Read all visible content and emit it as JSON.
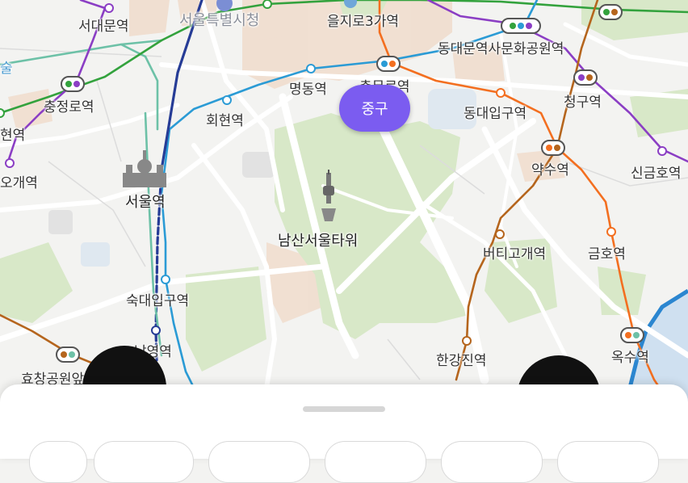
{
  "map": {
    "district_badge": "중구",
    "landmark_tower": "남산서울타워",
    "labels": {
      "seodaemun": "서대문역",
      "cityhall": "서울특별시청",
      "euljiro3": "을지로3가역",
      "ddp": "동대문역사문화공원역",
      "myeongdong": "명동역",
      "chungmuro": "충무로역",
      "dongdae": "동대입구역",
      "cheonggu": "청구역",
      "chungjeongno": "충정로역",
      "hoehyeon": "회현역",
      "aeogae_partial": "현역",
      "aeogae2": "오개역",
      "seoul_station": "서울역",
      "yaksu": "약수역",
      "singeumho": "신금호역",
      "beotigogae": "버티고개역",
      "geumho": "금호역",
      "sookmyung": "숙대입구역",
      "namyoung": "남영역",
      "hangangjin": "한강진역",
      "oksu": "옥수역",
      "hyochang": "효창공원앞역",
      "left_edge": "술"
    }
  },
  "colors": {
    "district_badge": "#7b5cf0",
    "line1": "#263c96",
    "line2": "#33a23d",
    "line3": "#f36f20",
    "line4": "#2b9bd5",
    "line5": "#8b3ec4",
    "line6": "#b5651d",
    "line_gyeongui": "#6dc1a7",
    "park": "#d8e8c8",
    "urban": "#f0dccc"
  },
  "bottom_sheet": {
    "chip_count": 6
  }
}
